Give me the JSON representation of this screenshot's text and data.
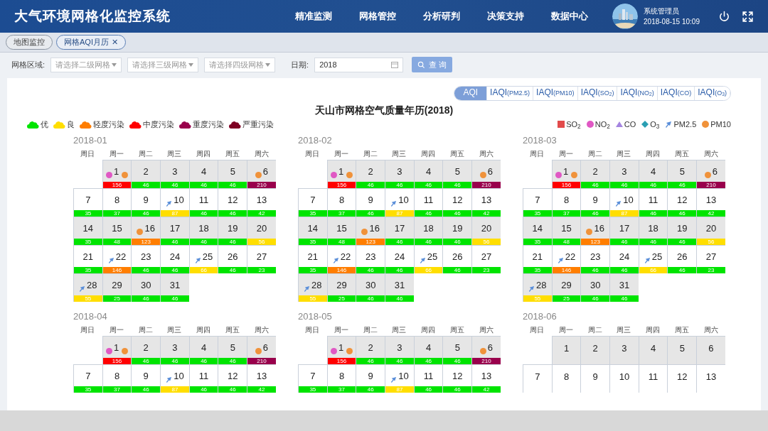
{
  "header": {
    "title": "大气环境网格化监控系统",
    "nav": [
      {
        "label": "精准监测"
      },
      {
        "label": "网格管控"
      },
      {
        "label": "分析研判"
      },
      {
        "label": "决策支持"
      },
      {
        "label": "数据中心"
      }
    ],
    "user": {
      "name": "系统管理员",
      "datetime": "2018-08-15 10:09"
    }
  },
  "open_tabs": [
    {
      "label": "地图监控",
      "selected": false
    },
    {
      "label": "网格AQI月历",
      "selected": true,
      "close": "✕"
    }
  ],
  "filters": {
    "region_label": "网格区域:",
    "selects": [
      {
        "placeholder": "请选择二级网格"
      },
      {
        "placeholder": "请选择三级网格"
      },
      {
        "placeholder": "请选择四级网格"
      }
    ],
    "date_label": "日期:",
    "date_value": "2018",
    "query_button": "查 询"
  },
  "index_tabs": [
    {
      "label": "AQI",
      "selected": true
    },
    {
      "label": "IAQI",
      "sub": "(PM2.5)",
      "selected": false
    },
    {
      "label": "IAQI",
      "sub": "(PM10)",
      "selected": false
    },
    {
      "label": "IAQI",
      "sub": "(SO$_{2}$)",
      "selected": false
    },
    {
      "label": "IAQI",
      "sub": "(NO$_{2}$)",
      "selected": false
    },
    {
      "label": "IAQI",
      "sub": "(CO)",
      "selected": false
    },
    {
      "label": "IAQI",
      "sub": "(O$_{3}$)",
      "selected": false
    }
  ],
  "title": "天山市网格空气质量年历(2018)",
  "aqi_legend": [
    {
      "label": "优",
      "color": "#00e400"
    },
    {
      "label": "良",
      "color": "#ffde00"
    },
    {
      "label": "轻度污染",
      "color": "#ff7e00"
    },
    {
      "label": "中度污染",
      "color": "#ff0000"
    },
    {
      "label": "重度污染",
      "color": "#99004c"
    },
    {
      "label": "严重污染",
      "color": "#7e0023"
    }
  ],
  "pollutant_legend": [
    {
      "kind": "so2",
      "label": "SO$_{2}$"
    },
    {
      "kind": "no2",
      "label": "NO$_{2}$"
    },
    {
      "kind": "co",
      "label": "CO"
    },
    {
      "kind": "o3",
      "label": "O$_{3}$"
    },
    {
      "kind": "pm25",
      "label": "PM2.5"
    },
    {
      "kind": "pm10",
      "label": "PM10"
    }
  ],
  "months": [
    {
      "title": "2018-01",
      "weekdays": [
        "周日",
        "周一",
        "周二",
        "周三",
        "周四",
        "周五",
        "周六"
      ],
      "weeks": [
        [
          {
            "kind": "blank"
          },
          {
            "kind": "day",
            "day": "1",
            "aqi": "156",
            "color": "#ff0000",
            "before": [
              {
                "kind": "no2"
              }
            ],
            "after": [
              {
                "kind": "pm10"
              }
            ]
          },
          {
            "kind": "day",
            "day": "2",
            "aqi": "46",
            "color": "#00e400"
          },
          {
            "kind": "day",
            "day": "3",
            "aqi": "46",
            "color": "#00e400"
          },
          {
            "kind": "day",
            "day": "4",
            "aqi": "46",
            "color": "#00e400"
          },
          {
            "kind": "day",
            "day": "5",
            "aqi": "46",
            "color": "#00e400"
          },
          {
            "kind": "day",
            "day": "6",
            "aqi": "210",
            "color": "#99004c",
            "before": [
              {
                "kind": "pm10"
              }
            ]
          }
        ],
        [
          {
            "kind": "day",
            "day": "7",
            "aqi": "35",
            "color": "#00e400"
          },
          {
            "kind": "day",
            "day": "8",
            "aqi": "37",
            "color": "#00e400"
          },
          {
            "kind": "day",
            "day": "9",
            "aqi": "46",
            "color": "#00e400"
          },
          {
            "kind": "day",
            "day": "10",
            "aqi": "87",
            "color": "#ffde00",
            "before": [
              {
                "kind": "pm25"
              }
            ]
          },
          {
            "kind": "day",
            "day": "11",
            "aqi": "46",
            "color": "#00e400"
          },
          {
            "kind": "day",
            "day": "12",
            "aqi": "46",
            "color": "#00e400"
          },
          {
            "kind": "day",
            "day": "13",
            "aqi": "42",
            "color": "#00e400"
          }
        ],
        [
          {
            "kind": "day",
            "day": "14",
            "aqi": "35",
            "color": "#00e400"
          },
          {
            "kind": "day",
            "day": "15",
            "aqi": "48",
            "color": "#00e400"
          },
          {
            "kind": "day",
            "day": "16",
            "aqi": "123",
            "color": "#ff7e00",
            "before": [
              {
                "kind": "pm10"
              }
            ]
          },
          {
            "kind": "day",
            "day": "17",
            "aqi": "46",
            "color": "#00e400"
          },
          {
            "kind": "day",
            "day": "18",
            "aqi": "46",
            "color": "#00e400"
          },
          {
            "kind": "day",
            "day": "19",
            "aqi": "46",
            "color": "#00e400"
          },
          {
            "kind": "day",
            "day": "20",
            "aqi": "56",
            "color": "#ffde00"
          }
        ],
        [
          {
            "kind": "day",
            "day": "21",
            "aqi": "35",
            "color": "#00e400"
          },
          {
            "kind": "day",
            "day": "22",
            "aqi": "146",
            "color": "#ff7e00",
            "before": [
              {
                "kind": "pm25"
              }
            ]
          },
          {
            "kind": "day",
            "day": "23",
            "aqi": "46",
            "color": "#00e400"
          },
          {
            "kind": "day",
            "day": "24",
            "aqi": "46",
            "color": "#00e400"
          },
          {
            "kind": "day",
            "day": "25",
            "aqi": "66",
            "color": "#ffde00",
            "before": [
              {
                "kind": "pm25"
              }
            ]
          },
          {
            "kind": "day",
            "day": "26",
            "aqi": "46",
            "color": "#00e400"
          },
          {
            "kind": "day",
            "day": "27",
            "aqi": "23",
            "color": "#00e400"
          }
        ],
        [
          {
            "kind": "day",
            "day": "28",
            "aqi": "55",
            "color": "#ffde00",
            "before": [
              {
                "kind": "pm25"
              }
            ]
          },
          {
            "kind": "day",
            "day": "29",
            "aqi": "25",
            "color": "#00e400"
          },
          {
            "kind": "day",
            "day": "30",
            "aqi": "46",
            "color": "#00e400"
          },
          {
            "kind": "day",
            "day": "31",
            "aqi": "46",
            "color": "#00e400"
          }
        ]
      ]
    },
    {
      "title": "2018-02",
      "weekdays": [
        "周日",
        "周一",
        "周二",
        "周三",
        "周四",
        "周五",
        "周六"
      ],
      "weeks": [
        [
          {
            "kind": "blank"
          },
          {
            "kind": "day",
            "day": "1",
            "aqi": "156",
            "color": "#ff0000",
            "before": [
              {
                "kind": "no2"
              }
            ],
            "after": [
              {
                "kind": "pm10"
              }
            ]
          },
          {
            "kind": "day",
            "day": "2",
            "aqi": "46",
            "color": "#00e400"
          },
          {
            "kind": "day",
            "day": "3",
            "aqi": "46",
            "color": "#00e400"
          },
          {
            "kind": "day",
            "day": "4",
            "aqi": "46",
            "color": "#00e400"
          },
          {
            "kind": "day",
            "day": "5",
            "aqi": "46",
            "color": "#00e400"
          },
          {
            "kind": "day",
            "day": "6",
            "aqi": "210",
            "color": "#99004c",
            "before": [
              {
                "kind": "pm10"
              }
            ]
          }
        ],
        [
          {
            "kind": "day",
            "day": "7",
            "aqi": "35",
            "color": "#00e400"
          },
          {
            "kind": "day",
            "day": "8",
            "aqi": "37",
            "color": "#00e400"
          },
          {
            "kind": "day",
            "day": "9",
            "aqi": "46",
            "color": "#00e400"
          },
          {
            "kind": "day",
            "day": "10",
            "aqi": "87",
            "color": "#ffde00",
            "before": [
              {
                "kind": "pm25"
              }
            ]
          },
          {
            "kind": "day",
            "day": "11",
            "aqi": "46",
            "color": "#00e400"
          },
          {
            "kind": "day",
            "day": "12",
            "aqi": "46",
            "color": "#00e400"
          },
          {
            "kind": "day",
            "day": "13",
            "aqi": "42",
            "color": "#00e400"
          }
        ],
        [
          {
            "kind": "day",
            "day": "14",
            "aqi": "35",
            "color": "#00e400"
          },
          {
            "kind": "day",
            "day": "15",
            "aqi": "48",
            "color": "#00e400"
          },
          {
            "kind": "day",
            "day": "16",
            "aqi": "123",
            "color": "#ff7e00",
            "before": [
              {
                "kind": "pm10"
              }
            ]
          },
          {
            "kind": "day",
            "day": "17",
            "aqi": "46",
            "color": "#00e400"
          },
          {
            "kind": "day",
            "day": "18",
            "aqi": "46",
            "color": "#00e400"
          },
          {
            "kind": "day",
            "day": "19",
            "aqi": "46",
            "color": "#00e400"
          },
          {
            "kind": "day",
            "day": "20",
            "aqi": "56",
            "color": "#ffde00"
          }
        ],
        [
          {
            "kind": "day",
            "day": "21",
            "aqi": "35",
            "color": "#00e400"
          },
          {
            "kind": "day",
            "day": "22",
            "aqi": "146",
            "color": "#ff7e00",
            "before": [
              {
                "kind": "pm25"
              }
            ]
          },
          {
            "kind": "day",
            "day": "23",
            "aqi": "46",
            "color": "#00e400"
          },
          {
            "kind": "day",
            "day": "24",
            "aqi": "46",
            "color": "#00e400"
          },
          {
            "kind": "day",
            "day": "25",
            "aqi": "66",
            "color": "#ffde00",
            "before": [
              {
                "kind": "pm25"
              }
            ]
          },
          {
            "kind": "day",
            "day": "26",
            "aqi": "46",
            "color": "#00e400"
          },
          {
            "kind": "day",
            "day": "27",
            "aqi": "23",
            "color": "#00e400"
          }
        ],
        [
          {
            "kind": "day",
            "day": "28",
            "aqi": "55",
            "color": "#ffde00",
            "before": [
              {
                "kind": "pm25"
              }
            ]
          },
          {
            "kind": "day",
            "day": "29",
            "aqi": "25",
            "color": "#00e400"
          },
          {
            "kind": "day",
            "day": "30",
            "aqi": "46",
            "color": "#00e400"
          },
          {
            "kind": "day",
            "day": "31",
            "aqi": "46",
            "color": "#00e400"
          }
        ]
      ]
    },
    {
      "title": "2018-03",
      "weekdays": [
        "周日",
        "周一",
        "周二",
        "周三",
        "周四",
        "周五",
        "周六"
      ],
      "weeks": [
        [
          {
            "kind": "blank"
          },
          {
            "kind": "day",
            "day": "1",
            "aqi": "156",
            "color": "#ff0000",
            "before": [
              {
                "kind": "no2"
              }
            ],
            "after": [
              {
                "kind": "pm10"
              }
            ]
          },
          {
            "kind": "day",
            "day": "2",
            "aqi": "46",
            "color": "#00e400"
          },
          {
            "kind": "day",
            "day": "3",
            "aqi": "46",
            "color": "#00e400"
          },
          {
            "kind": "day",
            "day": "4",
            "aqi": "46",
            "color": "#00e400"
          },
          {
            "kind": "day",
            "day": "5",
            "aqi": "46",
            "color": "#00e400"
          },
          {
            "kind": "day",
            "day": "6",
            "aqi": "210",
            "color": "#99004c",
            "before": [
              {
                "kind": "pm10"
              }
            ]
          }
        ],
        [
          {
            "kind": "day",
            "day": "7",
            "aqi": "35",
            "color": "#00e400"
          },
          {
            "kind": "day",
            "day": "8",
            "aqi": "37",
            "color": "#00e400"
          },
          {
            "kind": "day",
            "day": "9",
            "aqi": "46",
            "color": "#00e400"
          },
          {
            "kind": "day",
            "day": "10",
            "aqi": "87",
            "color": "#ffde00",
            "before": [
              {
                "kind": "pm25"
              }
            ]
          },
          {
            "kind": "day",
            "day": "11",
            "aqi": "46",
            "color": "#00e400"
          },
          {
            "kind": "day",
            "day": "12",
            "aqi": "46",
            "color": "#00e400"
          },
          {
            "kind": "day",
            "day": "13",
            "aqi": "42",
            "color": "#00e400"
          }
        ],
        [
          {
            "kind": "day",
            "day": "14",
            "aqi": "35",
            "color": "#00e400"
          },
          {
            "kind": "day",
            "day": "15",
            "aqi": "48",
            "color": "#00e400"
          },
          {
            "kind": "day",
            "day": "16",
            "aqi": "123",
            "color": "#ff7e00",
            "before": [
              {
                "kind": "pm10"
              }
            ]
          },
          {
            "kind": "day",
            "day": "17",
            "aqi": "46",
            "color": "#00e400"
          },
          {
            "kind": "day",
            "day": "18",
            "aqi": "46",
            "color": "#00e400"
          },
          {
            "kind": "day",
            "day": "19",
            "aqi": "46",
            "color": "#00e400"
          },
          {
            "kind": "day",
            "day": "20",
            "aqi": "56",
            "color": "#ffde00"
          }
        ],
        [
          {
            "kind": "day",
            "day": "21",
            "aqi": "35",
            "color": "#00e400"
          },
          {
            "kind": "day",
            "day": "22",
            "aqi": "146",
            "color": "#ff7e00",
            "before": [
              {
                "kind": "pm25"
              }
            ]
          },
          {
            "kind": "day",
            "day": "23",
            "aqi": "46",
            "color": "#00e400"
          },
          {
            "kind": "day",
            "day": "24",
            "aqi": "46",
            "color": "#00e400"
          },
          {
            "kind": "day",
            "day": "25",
            "aqi": "66",
            "color": "#ffde00",
            "before": [
              {
                "kind": "pm25"
              }
            ]
          },
          {
            "kind": "day",
            "day": "26",
            "aqi": "46",
            "color": "#00e400"
          },
          {
            "kind": "day",
            "day": "27",
            "aqi": "23",
            "color": "#00e400"
          }
        ],
        [
          {
            "kind": "day",
            "day": "28",
            "aqi": "55",
            "color": "#ffde00",
            "before": [
              {
                "kind": "pm25"
              }
            ]
          },
          {
            "kind": "day",
            "day": "29",
            "aqi": "25",
            "color": "#00e400"
          },
          {
            "kind": "day",
            "day": "30",
            "aqi": "46",
            "color": "#00e400"
          },
          {
            "kind": "day",
            "day": "31",
            "aqi": "46",
            "color": "#00e400"
          }
        ]
      ]
    },
    {
      "title": "2018-04",
      "weekdays": [
        "周日",
        "周一",
        "周二",
        "周三",
        "周四",
        "周五",
        "周六"
      ],
      "weeks": [
        [
          {
            "kind": "blank"
          },
          {
            "kind": "day",
            "day": "1",
            "aqi": "156",
            "color": "#ff0000",
            "before": [
              {
                "kind": "no2"
              }
            ],
            "after": [
              {
                "kind": "pm10"
              }
            ]
          },
          {
            "kind": "day",
            "day": "2",
            "aqi": "46",
            "color": "#00e400"
          },
          {
            "kind": "day",
            "day": "3",
            "aqi": "46",
            "color": "#00e400"
          },
          {
            "kind": "day",
            "day": "4",
            "aqi": "46",
            "color": "#00e400"
          },
          {
            "kind": "day",
            "day": "5",
            "aqi": "46",
            "color": "#00e400"
          },
          {
            "kind": "day",
            "day": "6",
            "aqi": "210",
            "color": "#99004c",
            "before": [
              {
                "kind": "pm10"
              }
            ]
          }
        ],
        [
          {
            "kind": "day",
            "day": "7",
            "aqi": "35",
            "color": "#00e400"
          },
          {
            "kind": "day",
            "day": "8",
            "aqi": "37",
            "color": "#00e400"
          },
          {
            "kind": "day",
            "day": "9",
            "aqi": "46",
            "color": "#00e400"
          },
          {
            "kind": "day",
            "day": "10",
            "aqi": "87",
            "color": "#ffde00",
            "before": [
              {
                "kind": "pm25"
              }
            ]
          },
          {
            "kind": "day",
            "day": "11",
            "aqi": "46",
            "color": "#00e400"
          },
          {
            "kind": "day",
            "day": "12",
            "aqi": "46",
            "color": "#00e400"
          },
          {
            "kind": "day",
            "day": "13",
            "aqi": "42",
            "color": "#00e400"
          }
        ]
      ]
    },
    {
      "title": "2018-05",
      "weekdays": [
        "周日",
        "周一",
        "周二",
        "周三",
        "周四",
        "周五",
        "周六"
      ],
      "weeks": [
        [
          {
            "kind": "blank"
          },
          {
            "kind": "day",
            "day": "1",
            "aqi": "156",
            "color": "#ff0000",
            "before": [
              {
                "kind": "no2"
              }
            ],
            "after": [
              {
                "kind": "pm10"
              }
            ]
          },
          {
            "kind": "day",
            "day": "2",
            "aqi": "46",
            "color": "#00e400"
          },
          {
            "kind": "day",
            "day": "3",
            "aqi": "46",
            "color": "#00e400"
          },
          {
            "kind": "day",
            "day": "4",
            "aqi": "46",
            "color": "#00e400"
          },
          {
            "kind": "day",
            "day": "5",
            "aqi": "46",
            "color": "#00e400"
          },
          {
            "kind": "day",
            "day": "6",
            "aqi": "210",
            "color": "#99004c",
            "before": [
              {
                "kind": "pm10"
              }
            ]
          }
        ],
        [
          {
            "kind": "day",
            "day": "7",
            "aqi": "35",
            "color": "#00e400"
          },
          {
            "kind": "day",
            "day": "8",
            "aqi": "37",
            "color": "#00e400"
          },
          {
            "kind": "day",
            "day": "9",
            "aqi": "46",
            "color": "#00e400"
          },
          {
            "kind": "day",
            "day": "10",
            "aqi": "87",
            "color": "#ffde00",
            "before": [
              {
                "kind": "pm25"
              }
            ]
          },
          {
            "kind": "day",
            "day": "11",
            "aqi": "46",
            "color": "#00e400"
          },
          {
            "kind": "day",
            "day": "12",
            "aqi": "46",
            "color": "#00e400"
          },
          {
            "kind": "day",
            "day": "13",
            "aqi": "42",
            "color": "#00e400"
          }
        ]
      ]
    },
    {
      "title": "2018-06",
      "weekdays": [
        "周日",
        "周一",
        "周二",
        "周三",
        "周四",
        "周五",
        "周六"
      ],
      "weeks": [
        [
          {
            "kind": "blank"
          },
          {
            "kind": "day",
            "day": "1"
          },
          {
            "kind": "day",
            "day": "2"
          },
          {
            "kind": "day",
            "day": "3"
          },
          {
            "kind": "day",
            "day": "4"
          },
          {
            "kind": "day",
            "day": "5"
          },
          {
            "kind": "day",
            "day": "6"
          }
        ],
        [
          {
            "kind": "day",
            "day": "7"
          },
          {
            "kind": "day",
            "day": "8"
          },
          {
            "kind": "day",
            "day": "9"
          },
          {
            "kind": "day",
            "day": "10"
          },
          {
            "kind": "day",
            "day": "11"
          },
          {
            "kind": "day",
            "day": "12"
          },
          {
            "kind": "day",
            "day": "13"
          }
        ]
      ]
    }
  ]
}
